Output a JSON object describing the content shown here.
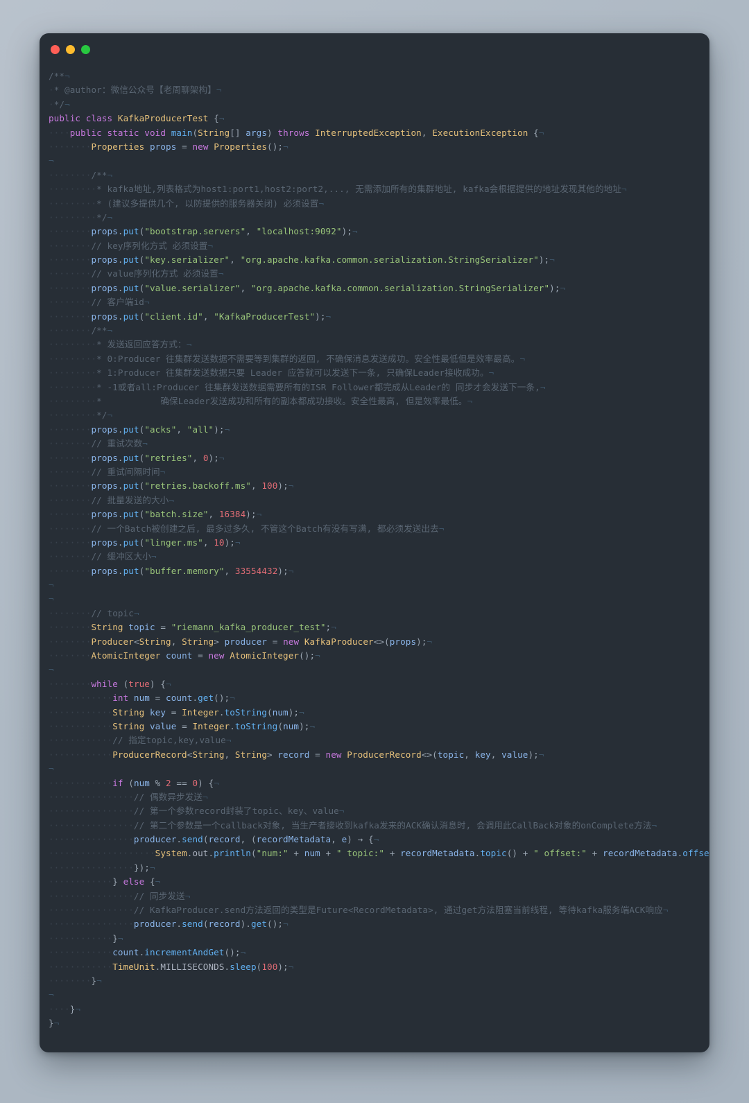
{
  "window": {
    "background_color": "#272e36",
    "page_background_color": "#b0bac4",
    "traffic_lights": [
      {
        "name": "close",
        "color": "#ff5f57"
      },
      {
        "name": "minimize",
        "color": "#febc2e"
      },
      {
        "name": "maximize",
        "color": "#28c840"
      }
    ]
  },
  "theme": {
    "comment": "#5a6673",
    "keyword": "#c678dd",
    "type": "#e5c07b",
    "function": "#61afef",
    "identifier": "#8ab4e8",
    "string": "#98c379",
    "number": "#e06c75",
    "punctuation": "#9aa5b1",
    "whitespace_marker": "#39424d",
    "eol_marker": "#3d5366"
  },
  "code": {
    "language": "java",
    "class_name": "KafkaProducerTest",
    "author_comment": "@author：微信公众号【老周聊架构】",
    "show_whitespace_markers": true,
    "show_eol_markers": true,
    "lines": [
      "/**",
      " * @author：微信公众号【老周聊架构】",
      " */",
      "public class KafkaProducerTest {",
      "    public static void main(String[] args) throws InterruptedException, ExecutionException {",
      "        Properties props = new Properties();",
      "",
      "        /**",
      "         * kafka地址,列表格式为host1:port1,host2:port2,..., 无需添加所有的集群地址, kafka会根据提供的地址发现其他的地址",
      "         * (建议多提供几个, 以防提供的服务器关闭) 必须设置",
      "         */",
      "        props.put(\"bootstrap.servers\", \"localhost:9092\");",
      "        // key序列化方式 必须设置",
      "        props.put(\"key.serializer\", \"org.apache.kafka.common.serialization.StringSerializer\");",
      "        // value序列化方式 必须设置",
      "        props.put(\"value.serializer\", \"org.apache.kafka.common.serialization.StringSerializer\");",
      "        // 客户端id",
      "        props.put(\"client.id\", \"KafkaProducerTest\");",
      "        /**",
      "         * 发送返回应答方式：",
      "         * 0:Producer 往集群发送数据不需要等到集群的返回, 不确保消息发送成功。安全性最低但是效率最高。",
      "         * 1:Producer 往集群发送数据只要 Leader 应答就可以发送下一条, 只确保Leader接收成功。",
      "         * -1或者all:Producer 往集群发送数据需要所有的ISR Follower都完成从Leader的 同步才会发送下一条,",
      "         *           确保Leader发送成功和所有的副本都成功接收。安全性最高, 但是效率最低。",
      "         */",
      "        props.put(\"acks\", \"all\");",
      "        // 重试次数",
      "        props.put(\"retries\", 0);",
      "        // 重试间隔时间",
      "        props.put(\"retries.backoff.ms\", 100);",
      "        // 批量发送的大小",
      "        props.put(\"batch.size\", 16384);",
      "        // 一个Batch被创建之后, 最多过多久, 不管这个Batch有没有写满, 都必须发送出去",
      "        props.put(\"linger.ms\", 10);",
      "        // 缓冲区大小",
      "        props.put(\"buffer.memory\", 33554432);",
      "",
      "",
      "        // topic",
      "        String topic = \"riemann_kafka_producer_test\";",
      "        Producer<String, String> producer = new KafkaProducer<>(props);",
      "        AtomicInteger count = new AtomicInteger();",
      "",
      "        while (true) {",
      "            int num = count.get();",
      "            String key = Integer.toString(num);",
      "            String value = Integer.toString(num);",
      "            // 指定topic,key,value",
      "            ProducerRecord<String, String> record = new ProducerRecord<>(topic, key, value);",
      "",
      "            if (num % 2 == 0) {",
      "                // 偶数异步发送",
      "                // 第一个参数record封装了topic、key、value",
      "                // 第二个参数是一个callback对象, 当生产者接收到kafka发来的ACK确认消息时, 会调用此CallBack对象的onComplete方法",
      "                producer.send(record, (recordMetadata, e) -> {",
      "                    System.out.println(\"num:\" + num + \" topic:\" + recordMetadata.topic() + \" offset:\" + recordMetadata.offset());",
      "                });",
      "            } else {",
      "                // 同步发送",
      "                // KafkaProducer.send方法返回的类型是Future<RecordMetadata>, 通过get方法阻塞当前线程, 等待kafka服务端ACK响应",
      "                producer.send(record).get();",
      "            }",
      "            count.incrementAndGet();",
      "            TimeUnit.MILLISECONDS.sleep(100);",
      "        }",
      "",
      "    }",
      "}"
    ]
  }
}
